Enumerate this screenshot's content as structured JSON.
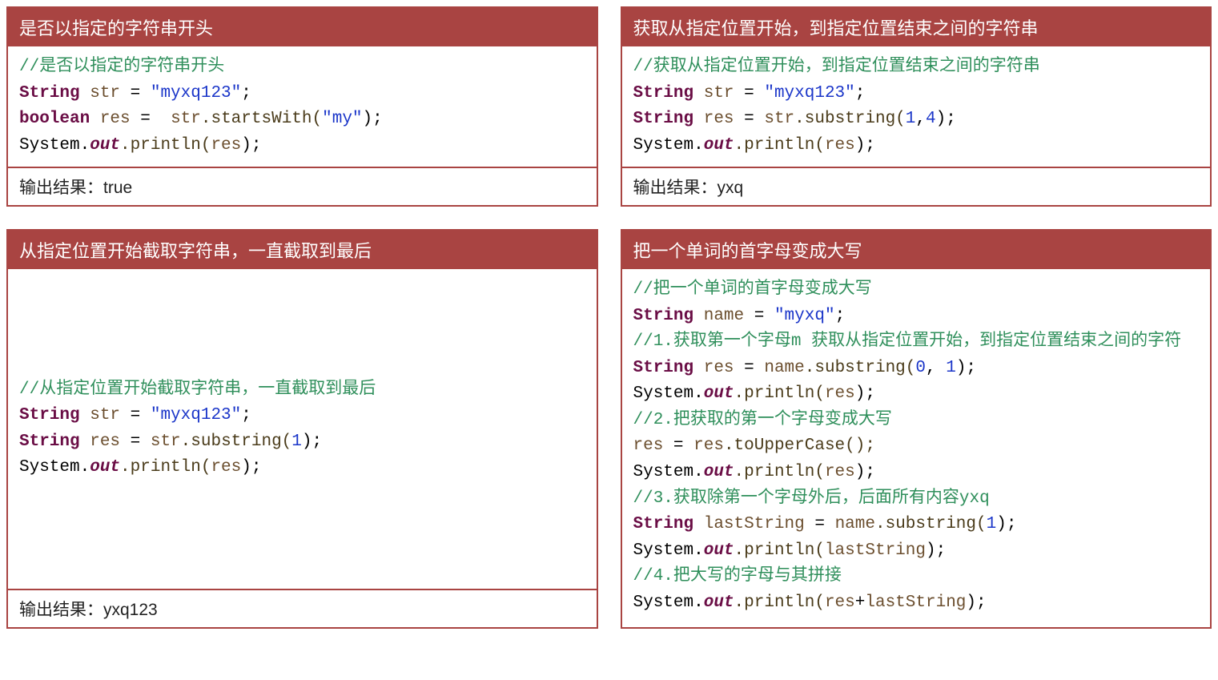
{
  "cards": [
    {
      "title": "是否以指定的字符串开头",
      "comment1": "//是否以指定的字符串开头",
      "line1_a": "String ",
      "line1_b": "str",
      "line1_c": " = ",
      "line1_d": "\"myxq123\"",
      "line1_e": ";",
      "line2_a": "boolean ",
      "line2_b": "res",
      "line2_c": " =  ",
      "line2_d": "str",
      "line2_e": ".startsWith(",
      "line2_f": "\"my\"",
      "line2_g": ");",
      "line3_a": "System.",
      "line3_b": "out",
      "line3_c": ".println(",
      "line3_d": "res",
      "line3_e": ");",
      "output": "输出结果：true"
    },
    {
      "title": "获取从指定位置开始，到指定位置结束之间的字符串",
      "comment1": "//获取从指定位置开始，到指定位置结束之间的字符串",
      "line1_a": "String ",
      "line1_b": "str",
      "line1_c": " = ",
      "line1_d": "\"myxq123\"",
      "line1_e": ";",
      "line2_a": "String ",
      "line2_b": "res",
      "line2_c": " = ",
      "line2_d": "str",
      "line2_e": ".substring(",
      "line2_f": "1",
      "line2_g": ",",
      "line2_h": "4",
      "line2_i": ");",
      "line3_a": "System.",
      "line3_b": "out",
      "line3_c": ".println(",
      "line3_d": "res",
      "line3_e": ");",
      "output": "输出结果：yxq"
    },
    {
      "title": "从指定位置开始截取字符串，一直截取到最后",
      "comment1": "//从指定位置开始截取字符串，一直截取到最后",
      "line1_a": "String ",
      "line1_b": "str",
      "line1_c": " = ",
      "line1_d": "\"myxq123\"",
      "line1_e": ";",
      "line2_a": "String ",
      "line2_b": "res",
      "line2_c": " = ",
      "line2_d": "str",
      "line2_e": ".substring(",
      "line2_f": "1",
      "line2_g": ");",
      "line3_a": "System.",
      "line3_b": "out",
      "line3_c": ".println(",
      "line3_d": "res",
      "line3_e": ");",
      "output": "输出结果：yxq123"
    },
    {
      "title": "把一个单词的首字母变成大写",
      "c1": "//把一个单词的首字母变成大写",
      "l1_a": "String ",
      "l1_b": "name",
      "l1_c": " = ",
      "l1_d": "\"myxq\"",
      "l1_e": ";",
      "c2": "//1.获取第一个字母m 获取从指定位置开始，到指定位置结束之间的字符",
      "l2_a": "String ",
      "l2_b": "res",
      "l2_c": " = ",
      "l2_d": "name",
      "l2_e": ".substring(",
      "l2_f": "0",
      "l2_g": ", ",
      "l2_h": "1",
      "l2_i": ");",
      "l3_a": "System.",
      "l3_b": "out",
      "l3_c": ".println(",
      "l3_d": "res",
      "l3_e": ");",
      "c3": "//2.把获取的第一个字母变成大写",
      "l4_a": "res",
      "l4_b": " = ",
      "l4_c": "res",
      "l4_d": ".toUpperCase();",
      "l5_a": "System.",
      "l5_b": "out",
      "l5_c": ".println(",
      "l5_d": "res",
      "l5_e": ");",
      "c4": "//3.获取除第一个字母外后，后面所有内容yxq",
      "l6_a": "String ",
      "l6_b": "lastString",
      "l6_c": " = ",
      "l6_d": "name",
      "l6_e": ".substring(",
      "l6_f": "1",
      "l6_g": ");",
      "l7_a": "System.",
      "l7_b": "out",
      "l7_c": ".println(",
      "l7_d": "lastString",
      "l7_e": ");",
      "c5": "//4.把大写的字母与其拼接",
      "l8_a": "System.",
      "l8_b": "out",
      "l8_c": ".println(",
      "l8_d": "res",
      "l8_e": "+",
      "l8_f": "lastString",
      "l8_g": ");"
    }
  ]
}
